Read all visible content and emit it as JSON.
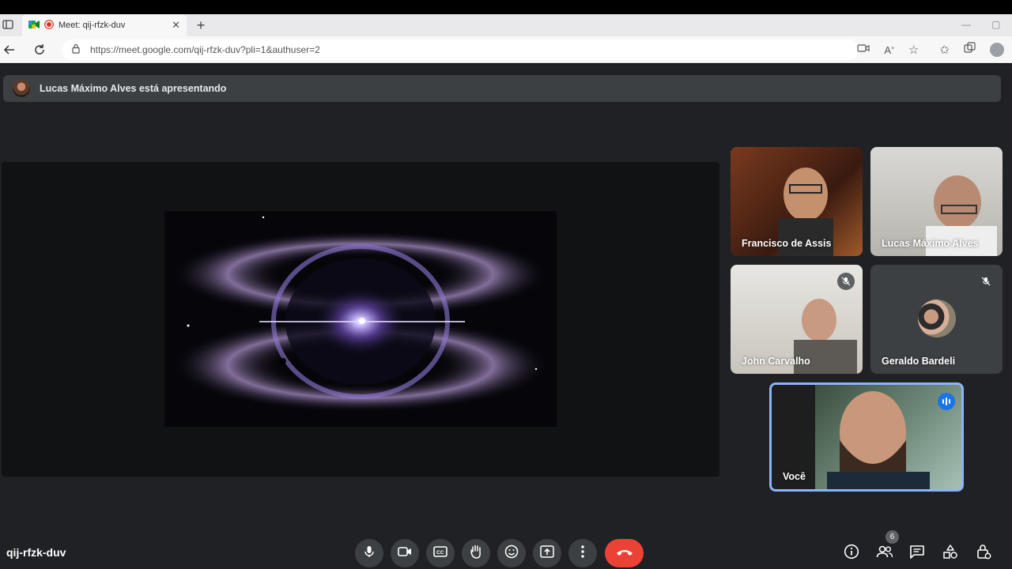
{
  "browser": {
    "tab_title": "Meet: qij-rfzk-duv",
    "url": "https://meet.google.com/qij-rfzk-duv?pli=1&authuser=2"
  },
  "meet": {
    "presenter_banner": "Lucas Máximo Alves está apresentando",
    "meeting_code": "qij-rfzk-duv",
    "participant_count": "6",
    "participants": [
      {
        "name": "Francisco de Assis",
        "muted": false
      },
      {
        "name": "Lucas Máximo Alves",
        "muted": false
      },
      {
        "name": "John Carvalho",
        "muted": true
      },
      {
        "name": "Geraldo Bardeli",
        "muted": true
      },
      {
        "name": "Você",
        "speaking": true
      }
    ]
  },
  "icons": {
    "controls": [
      "mic-icon",
      "camera-icon",
      "captions-icon",
      "raise-hand-icon",
      "emoji-icon",
      "present-icon",
      "more-options-icon",
      "end-call-icon"
    ],
    "right_controls": [
      "info-icon",
      "people-icon",
      "chat-icon",
      "activities-icon",
      "host-controls-icon"
    ]
  },
  "colors": {
    "meet_bg": "#202124",
    "control_bg": "#3c4043",
    "end_call": "#ea4335",
    "speaking_accent": "#1a73e8"
  }
}
